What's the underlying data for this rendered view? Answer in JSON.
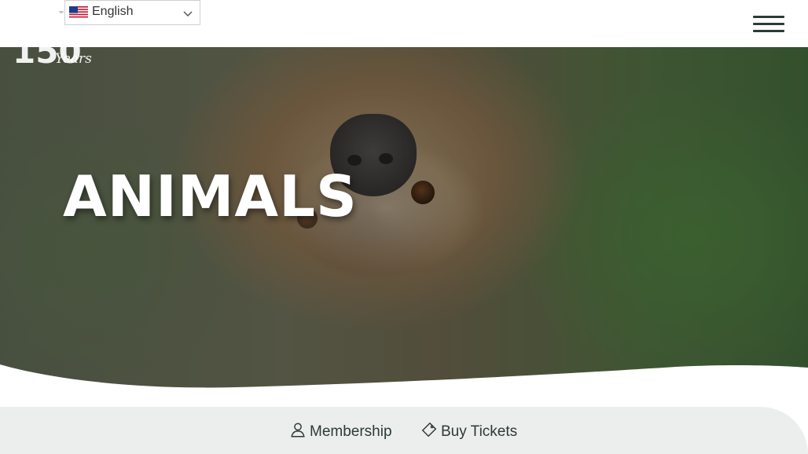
{
  "header": {
    "language_selector": {
      "selected": "English",
      "flag": "us-flag-icon"
    },
    "menu_icon": "hamburger-menu-icon",
    "logo": {
      "number": "150",
      "script_text": "Years"
    }
  },
  "hero": {
    "title": "ANIMALS",
    "image": "sloth-hanging-upside-down-photo"
  },
  "action_bar": {
    "items": [
      {
        "label": "Membership",
        "icon": "user-icon"
      },
      {
        "label": "Buy Tickets",
        "icon": "ticket-icon"
      }
    ]
  },
  "colors": {
    "text_dark": "#2c3a36",
    "action_bar_bg": "#eceeed",
    "hero_title": "#ffffff"
  }
}
